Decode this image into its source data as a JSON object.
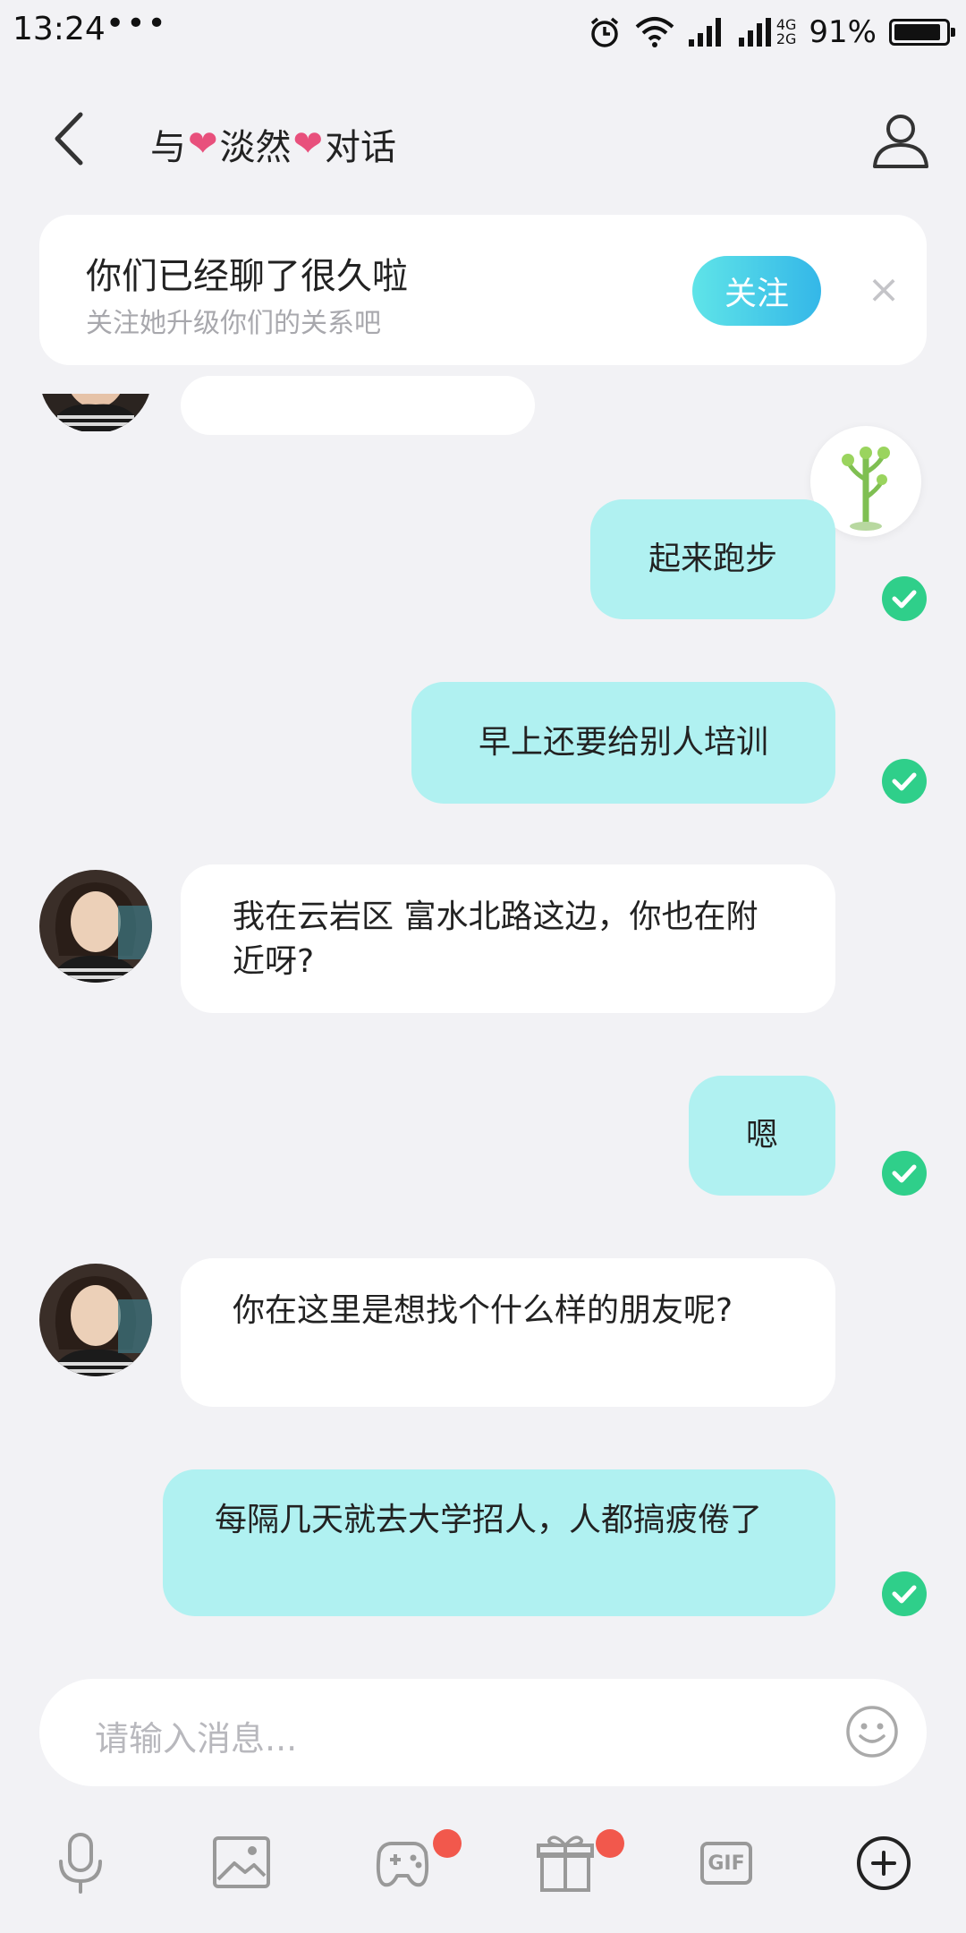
{
  "status_bar": {
    "time": "13:24",
    "dots": "•••",
    "network_top": "4G",
    "network_bottom": "2G",
    "battery_percent": "91%",
    "battery_level": 0.91
  },
  "header": {
    "title_prefix": "与",
    "title_name": "淡然",
    "title_suffix": "对话",
    "heart_symbol": "❤"
  },
  "banner": {
    "title": "你们已经聊了很久啦",
    "subtitle": "关注她升级你们的关系吧",
    "follow_label": "关注",
    "close_symbol": "×"
  },
  "messages": [
    {
      "dir": "out",
      "text": "起来跑步"
    },
    {
      "dir": "out",
      "text": "早上还要给别人培训"
    },
    {
      "dir": "in",
      "text": "我在云岩区 富水北路这边，你也在附近呀?"
    },
    {
      "dir": "out",
      "text": "嗯"
    },
    {
      "dir": "in",
      "text": "你在这里是想找个什么样的朋友呢?"
    },
    {
      "dir": "out",
      "text": "每隔几天就去大学招人，人都搞疲倦了"
    }
  ],
  "input": {
    "placeholder": "请输入消息..."
  },
  "toolbar": {
    "items": [
      "microphone-icon",
      "image-icon",
      "game-icon",
      "gift-icon",
      "gif-icon",
      "plus-icon"
    ],
    "gif_label": "GIF"
  },
  "colors": {
    "accent": "#34b7e8",
    "outgoing_bubble": "#b0f1f1",
    "check": "#2fcf8a",
    "badge": "#f2584c",
    "heart": "#e8507c"
  }
}
